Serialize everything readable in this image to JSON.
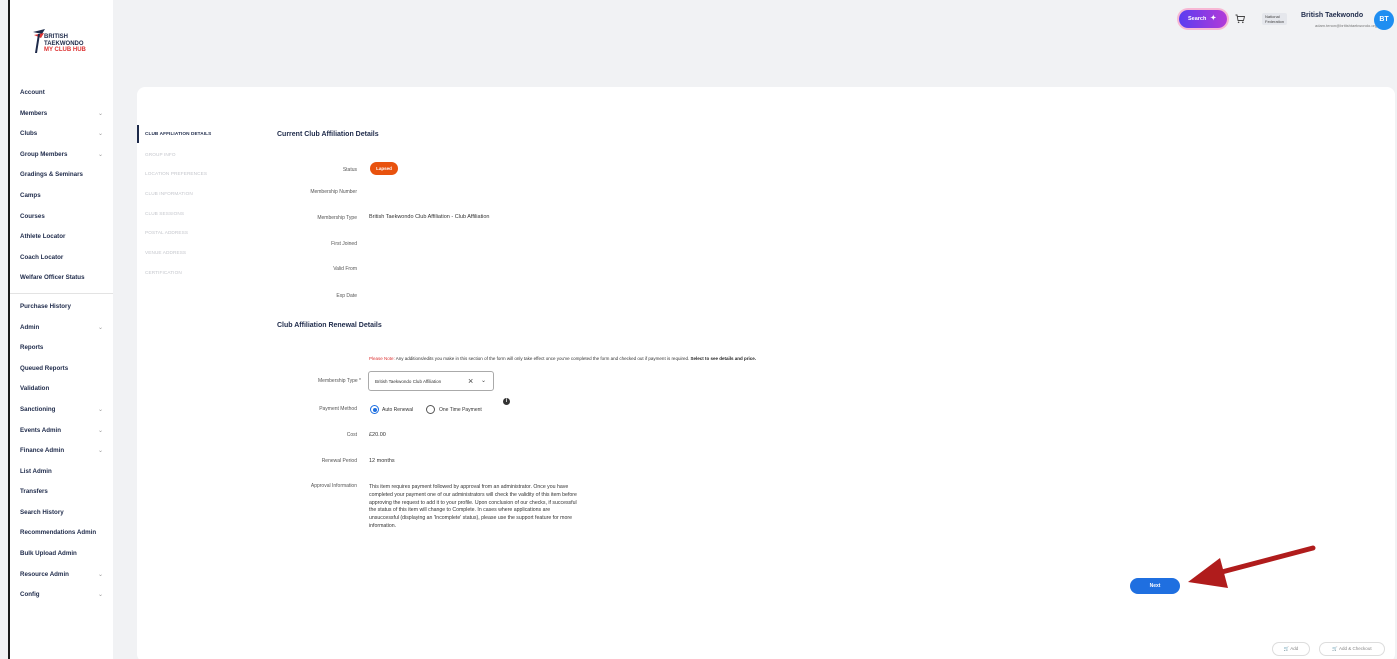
{
  "brand": {
    "line1": "BRITISH",
    "line2": "TAEKWONDO",
    "line3": "MY CLUB HUB"
  },
  "sidebar": {
    "items": [
      {
        "label": "Account",
        "chevron": false
      },
      {
        "label": "Members",
        "chevron": true
      },
      {
        "label": "Clubs",
        "chevron": true
      },
      {
        "label": "Group Members",
        "chevron": true
      },
      {
        "label": "Gradings & Seminars",
        "chevron": false
      },
      {
        "label": "Camps",
        "chevron": false
      },
      {
        "label": "Courses",
        "chevron": false
      },
      {
        "label": "Athlete Locator",
        "chevron": false
      },
      {
        "label": "Coach Locator",
        "chevron": false
      },
      {
        "label": "Welfare Officer Status",
        "chevron": false
      }
    ],
    "admin_items": [
      {
        "label": "Purchase History",
        "chevron": false
      },
      {
        "label": "Admin",
        "chevron": true
      },
      {
        "label": "Reports",
        "chevron": false
      },
      {
        "label": "Queued Reports",
        "chevron": false
      },
      {
        "label": "Validation",
        "chevron": false
      },
      {
        "label": "Sanctioning",
        "chevron": true
      },
      {
        "label": "Events Admin",
        "chevron": true
      },
      {
        "label": "Finance Admin",
        "chevron": true
      },
      {
        "label": "List Admin",
        "chevron": false
      },
      {
        "label": "Transfers",
        "chevron": false
      },
      {
        "label": "Search History",
        "chevron": false
      },
      {
        "label": "Recommendations Admin",
        "chevron": false
      },
      {
        "label": "Bulk Upload Admin",
        "chevron": false
      },
      {
        "label": "Resource Admin",
        "chevron": true
      },
      {
        "label": "Config",
        "chevron": true
      }
    ]
  },
  "topbar": {
    "search_label": "Search",
    "federation_badge": "National Federation",
    "federation_name": "British Taekwondo",
    "federation_email": "adam.tenon@britishtaekwondo.org",
    "avatar_initials": "BT"
  },
  "steps": [
    "CLUB AFFILIATION DETAILS",
    "GROUP INFO",
    "LOCATION PREFERENCES",
    "CLUB INFORMATION",
    "CLUB SESSIONS",
    "POSTAL ADDRESS",
    "VENUE ADDRESS",
    "CERTIFICATION"
  ],
  "current": {
    "title": "Current Club Affiliation Details",
    "status_label": "Status",
    "status_value": "Lapsed",
    "membership_number_label": "Membership Number",
    "membership_type_label": "Membership Type",
    "membership_type_value": "British Taekwondo Club Affiliation - Club Affiliation",
    "first_joined_label": "First Joined",
    "valid_from_label": "Valid From",
    "exp_date_label": "Exp Date"
  },
  "renewal": {
    "title": "Club Affiliation Renewal Details",
    "note_prefix": "Please Note:",
    "note_text": " Any additions/edits you make in this section of the form will only take effect once you've completed the form and checked out if payment is required. ",
    "note_bold": "Select to see details and price.",
    "membership_type_label": "Membership Type *",
    "membership_type_value": "British Taekwondo Club Affiliation",
    "payment_method_label": "Payment Method",
    "payment_option_1": "Auto Renewal",
    "payment_option_2": "One Time Payment",
    "cost_label": "Cost",
    "cost_value": "£20.00",
    "renewal_period_label": "Renewal Period",
    "renewal_period_value": "12 months",
    "approval_label": "Approval Information",
    "approval_text": "This item requires payment followed by approval from an administrator. Once you have completed your payment one of our administrators will check the validity of this item before approving the request to add it to your profile. Upon conclusion of our checks, if successful the status of this item will change to Complete. In cases where applications are unsuccessful (displaying an 'Incomplete' status), please use the support feature for more information."
  },
  "actions": {
    "next_label": "Next",
    "add_label": "Add",
    "add_checkout_label": "Add & Checkout"
  },
  "colors": {
    "primary": "#1f6fe0",
    "status_lapsed": "#e8520e",
    "navy": "#1e2a4a",
    "arrow": "#b01c1c"
  }
}
